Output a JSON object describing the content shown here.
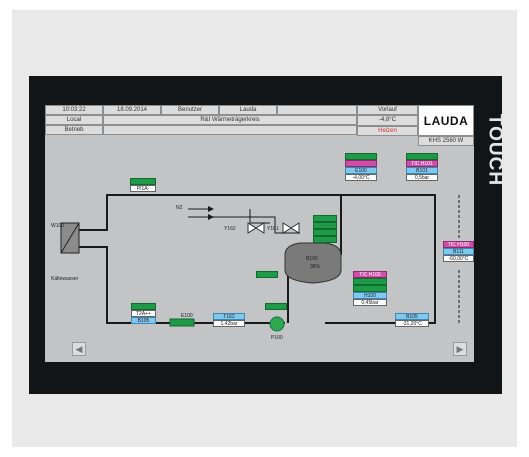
{
  "header": {
    "time": "10:03:22",
    "date": "18.09.2014",
    "user_label": "Benutzer",
    "user_value": "Lauda",
    "alarm_text": "",
    "flow_label": "Vorlauf",
    "mode": "Local",
    "operation": "Betrieb",
    "system_title": "R&I Wärmeträgerkreis",
    "flow_temp": "-4,8°C",
    "status": "Heizen",
    "model": "KHS 2560 W",
    "brand": "LAUDA"
  },
  "side_text": "TOUCH",
  "diagram": {
    "heat_exchanger_label": "W100",
    "coolant_label": "Kältewasser",
    "pt_label": "PI1A-",
    "nitrogen_label": "N2",
    "valve_left_label": "Y162",
    "valve_right_label": "Y161",
    "tank_label": "B100",
    "tank_value": "38%",
    "tank_alarm_1": "TIC H100",
    "tank_alarm_2": "H100",
    "tank_alarm_value": "0,45bar",
    "t100_value": "-4,00°C",
    "t100_code": "E100",
    "top_right_alarm": "TIC H101",
    "top_right_code": "B101",
    "top_right_value": "0,5bar",
    "right_alarm": "TIC H100",
    "right_code": "B111",
    "right_value": "-60,00°C",
    "bottom_left_code": "T2A++",
    "bottom_left_sub": "B105",
    "heater_label": "E100",
    "pipe_code": "T162",
    "pipe_value": "1,42bar",
    "pump_label": "P100",
    "bottom_right_code": "B105",
    "bottom_right_value": "-31,20°C"
  },
  "nav": {
    "left": "◀",
    "right": "▶"
  }
}
